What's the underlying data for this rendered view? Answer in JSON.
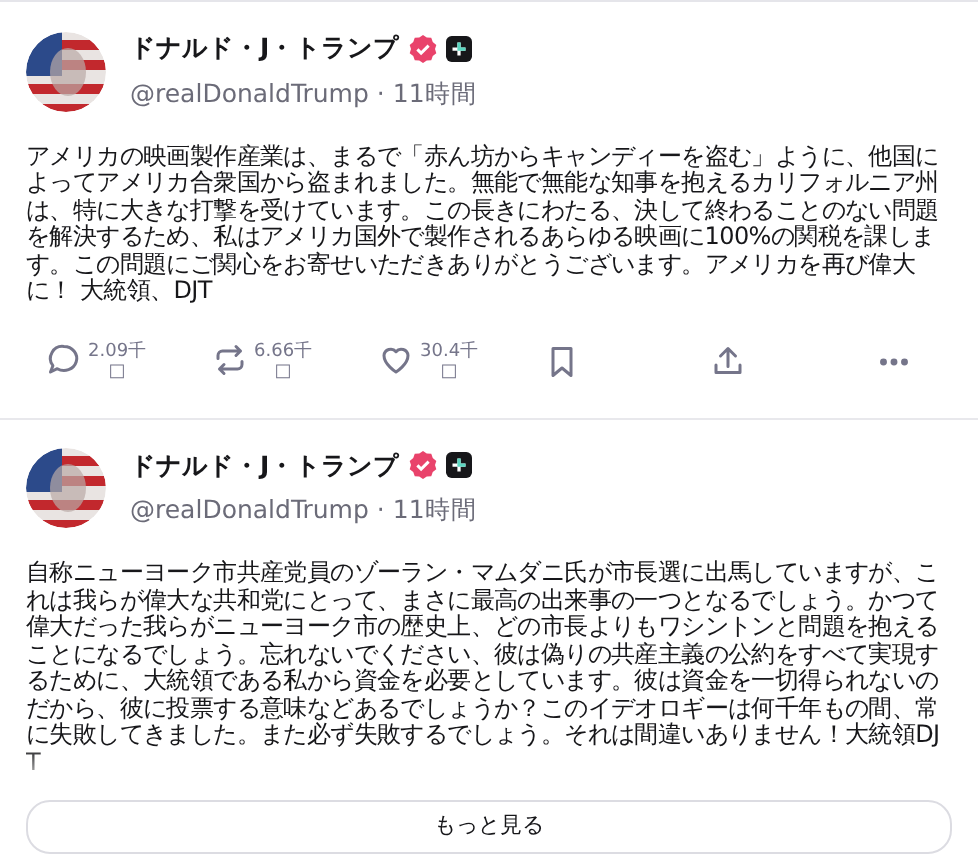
{
  "posts": [
    {
      "author": "ドナルド・J・トランプ",
      "verified": true,
      "handle": "@realDonaldTrump",
      "separator": "·",
      "time": "11時間",
      "text": "アメリカの映画製作産業は、まるで「赤ん坊からキャンディーを盗む」ように、他国によってアメリカ合衆国から盗まれました。無能で無能な知事を抱えるカリフォルニア州は、特に大きな打撃を受けています。この長きにわたる、決して終わることのない問題を解決するため、私はアメリカ国外で製作されるあらゆる映画に100%の関税を課します。この問題にご関心をお寄せいただきありがとうございます。アメリカを再び偉大に！ 大統領、DJT",
      "actions": [
        {
          "kind": "reply",
          "count": "2.09千",
          "unit": "□"
        },
        {
          "kind": "repost",
          "count": "6.66千",
          "unit": "□"
        },
        {
          "kind": "like",
          "count": "30.4千",
          "unit": "□"
        },
        {
          "kind": "bookmark"
        },
        {
          "kind": "share"
        },
        {
          "kind": "more"
        }
      ]
    },
    {
      "author": "ドナルド・J・トランプ",
      "verified": true,
      "handle": "@realDonaldTrump",
      "separator": "·",
      "time": "11時間",
      "text": "自称ニューヨーク市共産党員のゾーラン・マムダニ氏が市長選に出馬していますが、これは我らが偉大な共和党にとって、まさに最高の出来事の一つとなるでしょう。かつて偉大だった我らがニューヨーク市の歴史上、どの市長よりもワシントンと問題を抱えることになるでしょう。忘れないでください、彼は偽りの共産主義の公約をすべて実現するために、大統領である私から資金を必要としています。彼は資金を一切得られないのだから、彼に投票する意味などあるでしょうか？このイデオロギーは何千年もの間、常に失敗してきました。また必ず失敗するでしょう。それは間違いありません！大統領DJT",
      "truncated": true
    }
  ],
  "show_more": "もっと見る"
}
